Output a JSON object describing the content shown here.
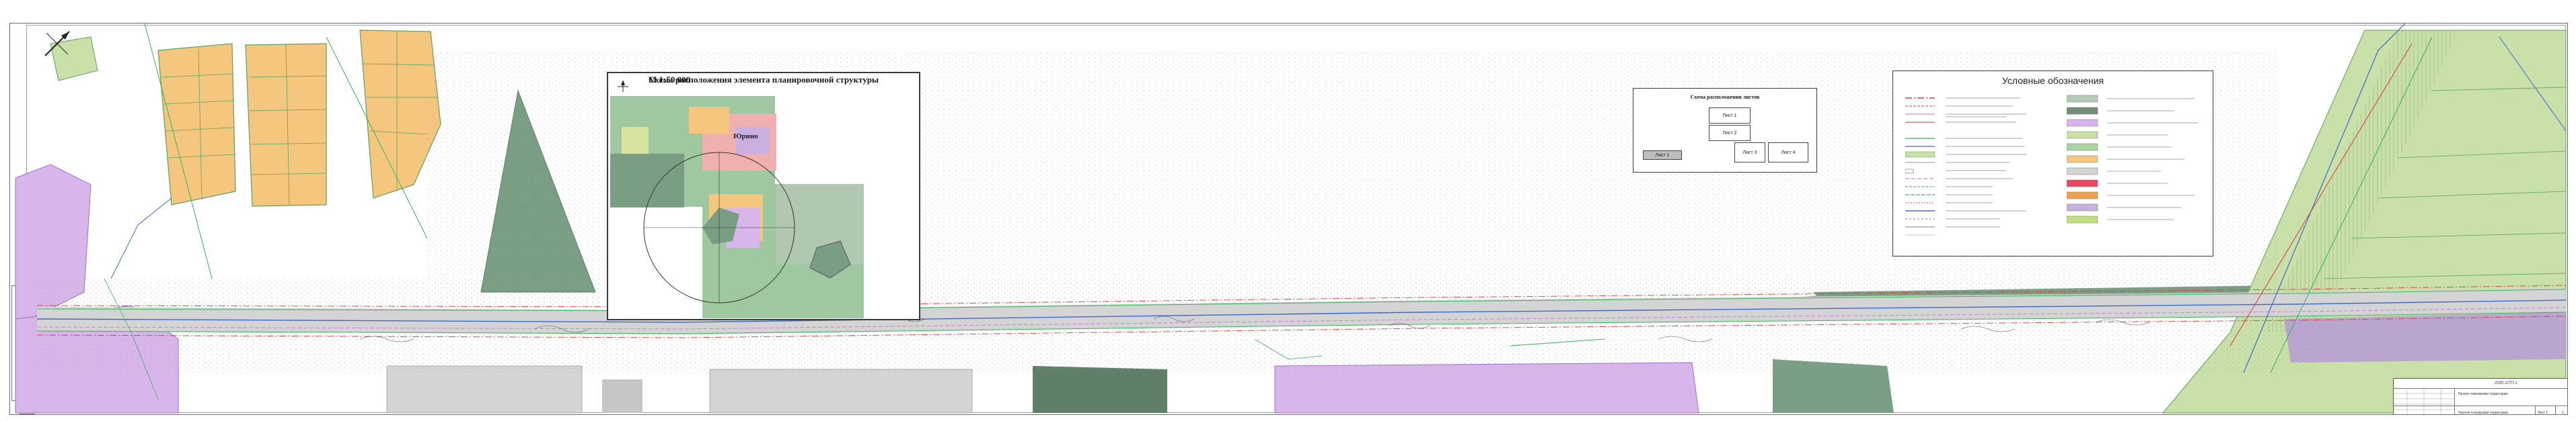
{
  "scheme": {
    "title": "Схема расположения элемента планировочной структуры",
    "scale": "М 1:50 000",
    "place_name": "Юрино"
  },
  "sheet_layout": {
    "title": "Схема расположения листов",
    "sheets": [
      "Лист 1",
      "Лист 2",
      "Лист 3",
      "Лист 4",
      "Лист 5"
    ],
    "active_sheet": "Лист 1"
  },
  "legend": {
    "title": "Условные обозначения",
    "colors": {
      "forest_dark": "#7a9e84",
      "agri_light": "#c9e0a8",
      "residential": "#f5c77e",
      "industrial": "#d8b6ec",
      "water": "#a9d3ee",
      "road": "#d4d4d4",
      "red_line": "#d83a3a",
      "green_line": "#35b35a",
      "blue_line": "#3c68d0"
    }
  },
  "title_block": {
    "code": "2020-1/ТП-1",
    "line1": "Проект планировки территории",
    "line2": "Чертеж планировки территории",
    "sheet": "Лист 1",
    "total_sheets": "5"
  },
  "compass": {
    "north_icon": "north-arrow-icon"
  }
}
